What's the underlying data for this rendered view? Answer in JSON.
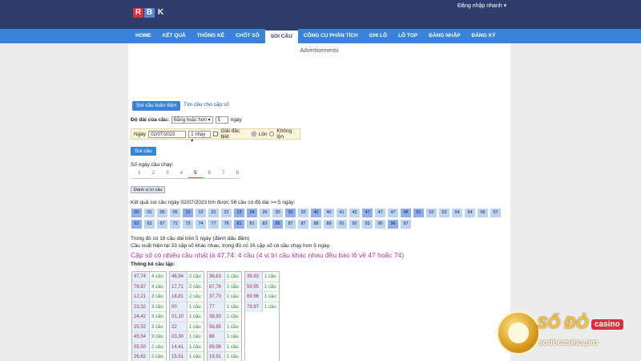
{
  "header": {
    "logo_letters": [
      "R",
      "B",
      "K"
    ],
    "login_label": "Đăng nhập nhanh ▾"
  },
  "nav": {
    "items": [
      "HOME",
      "KẾT QUẢ",
      "THỐNG KÊ",
      "CHỐT SỐ",
      "SOI CẦU",
      "CÔNG CỤ PHÂN TÍCH",
      "GHI LÔ",
      "LÔ TOP",
      "ĐĂNG NHẬP",
      "ĐĂNG KÝ"
    ],
    "active_index": 4
  },
  "ads_label": "Advertisements",
  "tabs": {
    "active": "Soi cầu toàn diện",
    "other": "Tìm cầu cho cặp số"
  },
  "form": {
    "length_label": "Độ dài của cầu:",
    "length_select": "Bằng hoặc hơn ▾",
    "length_value": "5",
    "length_unit": "ngày",
    "date_label": "Ngày",
    "date_value": "02/07/2023",
    "jump_select": "1 nháy ▾",
    "special_label": "Giải đặc biệt",
    "radio_on_label": "Lộn",
    "radio_off_label": "Không lộn",
    "run_button": "Soi cầu"
  },
  "days": {
    "label": "Số ngày cầu chạy:",
    "values": [
      "1",
      "2",
      "3",
      "4",
      "5",
      "6",
      "7",
      "8"
    ],
    "active_index": 4
  },
  "mark_button": "Đánh vị trí cầu",
  "result_text": "Kết quả soi cầu ngày 02/07/2023 tìm được 56 cầu có độ dài >= 5 ngày:",
  "numbers": [
    {
      "n": "00",
      "dark": true
    },
    {
      "n": "01",
      "dark": false
    },
    {
      "n": "05",
      "dark": false
    },
    {
      "n": "05",
      "dark": false
    },
    {
      "n": "12",
      "dark": true
    },
    {
      "n": "12",
      "dark": false
    },
    {
      "n": "21",
      "dark": false
    },
    {
      "n": "22",
      "dark": false
    },
    {
      "n": "23",
      "dark": true
    },
    {
      "n": "24",
      "dark": true
    },
    {
      "n": "26",
      "dark": false
    },
    {
      "n": "30",
      "dark": false
    },
    {
      "n": "32",
      "dark": true
    },
    {
      "n": "32",
      "dark": false
    },
    {
      "n": "40",
      "dark": true
    },
    {
      "n": "40",
      "dark": false
    },
    {
      "n": "41",
      "dark": false
    },
    {
      "n": "42",
      "dark": false
    },
    {
      "n": "47",
      "dark": true
    },
    {
      "n": "47",
      "dark": false
    },
    {
      "n": "47",
      "dark": false
    },
    {
      "n": "48",
      "dark": true
    },
    {
      "n": "51",
      "dark": true
    },
    {
      "n": "52",
      "dark": false
    },
    {
      "n": "52",
      "dark": false
    },
    {
      "n": "54",
      "dark": false
    },
    {
      "n": "54",
      "dark": false
    },
    {
      "n": "56",
      "dark": false
    },
    {
      "n": "57",
      "dark": false
    },
    {
      "n": "62",
      "dark": true
    },
    {
      "n": "63",
      "dark": false
    },
    {
      "n": "67",
      "dark": false
    },
    {
      "n": "71",
      "dark": false
    },
    {
      "n": "73",
      "dark": false
    },
    {
      "n": "74",
      "dark": false
    },
    {
      "n": "77",
      "dark": false
    },
    {
      "n": "78",
      "dark": false
    },
    {
      "n": "81",
      "dark": true
    },
    {
      "n": "81",
      "dark": false
    },
    {
      "n": "83",
      "dark": false
    },
    {
      "n": "85",
      "dark": true
    },
    {
      "n": "87",
      "dark": false
    },
    {
      "n": "87",
      "dark": false
    },
    {
      "n": "88",
      "dark": false
    },
    {
      "n": "89",
      "dark": false
    },
    {
      "n": "91",
      "dark": false
    },
    {
      "n": "92",
      "dark": false
    },
    {
      "n": "93",
      "dark": false
    },
    {
      "n": "95",
      "dark": false
    },
    {
      "n": "96",
      "dark": true
    },
    {
      "n": "97",
      "dark": false
    }
  ],
  "note1": "Trong đó có 18 cầu dài trên 5 ngày (đánh dấu đậm)",
  "note2": "Cầu xuất hiện tại 33 cặp số khác nhau, trong đó có 16 cặp số có cầu chạy hơn 5 ngày.",
  "headline": "Cặp số có nhiều cầu nhất là 47,74: 4 cầu (4 vị trí cầu khác nhau đều báo lô về 47 hoặc 74)",
  "stat_label": "Thống kê cầu lặp:",
  "stat_tables": [
    [
      [
        "47,74",
        "4 cầu"
      ],
      [
        "78,87",
        "4 cầu"
      ],
      [
        "12,21",
        "3 cầu"
      ],
      [
        "23,32",
        "3 cầu"
      ],
      [
        "24,42",
        "3 cầu"
      ],
      [
        "25,52",
        "3 cầu"
      ],
      [
        "45,54",
        "3 cầu"
      ],
      [
        "05,50",
        "2 cầu"
      ],
      [
        "26,62",
        "2 cầu"
      ]
    ],
    [
      [
        "48,84",
        "2 cầu"
      ],
      [
        "17,71",
        "2 cầu"
      ],
      [
        "18,81",
        "2 cầu"
      ],
      [
        "00",
        "1 cầu"
      ],
      [
        "01,10",
        "1 cầu"
      ],
      [
        "22",
        "1 cầu"
      ],
      [
        "03,30",
        "1 cầu"
      ],
      [
        "14,41",
        "1 cầu"
      ],
      [
        "15,51",
        "1 cầu"
      ]
    ],
    [
      [
        "36,63",
        "1 cầu"
      ],
      [
        "67,76",
        "1 cầu"
      ],
      [
        "37,73",
        "1 cầu"
      ],
      [
        "77",
        "1 cầu"
      ],
      [
        "38,83",
        "1 cầu"
      ],
      [
        "58,85",
        "1 cầu"
      ],
      [
        "88",
        "1 cầu"
      ],
      [
        "89,98",
        "1 cầu"
      ],
      [
        "19,91",
        "1 cầu"
      ]
    ],
    [
      [
        "39,93",
        "1 cầu"
      ],
      [
        "59,95",
        "1 cầu"
      ],
      [
        "69,96",
        "1 cầu"
      ],
      [
        "79,97",
        "1 cầu"
      ]
    ]
  ],
  "watermark": {
    "title": "SỐ ĐỎ",
    "badge": "casino",
    "url": "sodocasino.pro"
  },
  "colors": {
    "header_bg": "#2f3d6c",
    "nav_bg": "#3b82d9",
    "cell_light": "#bcd3f5",
    "cell_dark": "#8fb0ee",
    "headline": "#a23aa0"
  }
}
